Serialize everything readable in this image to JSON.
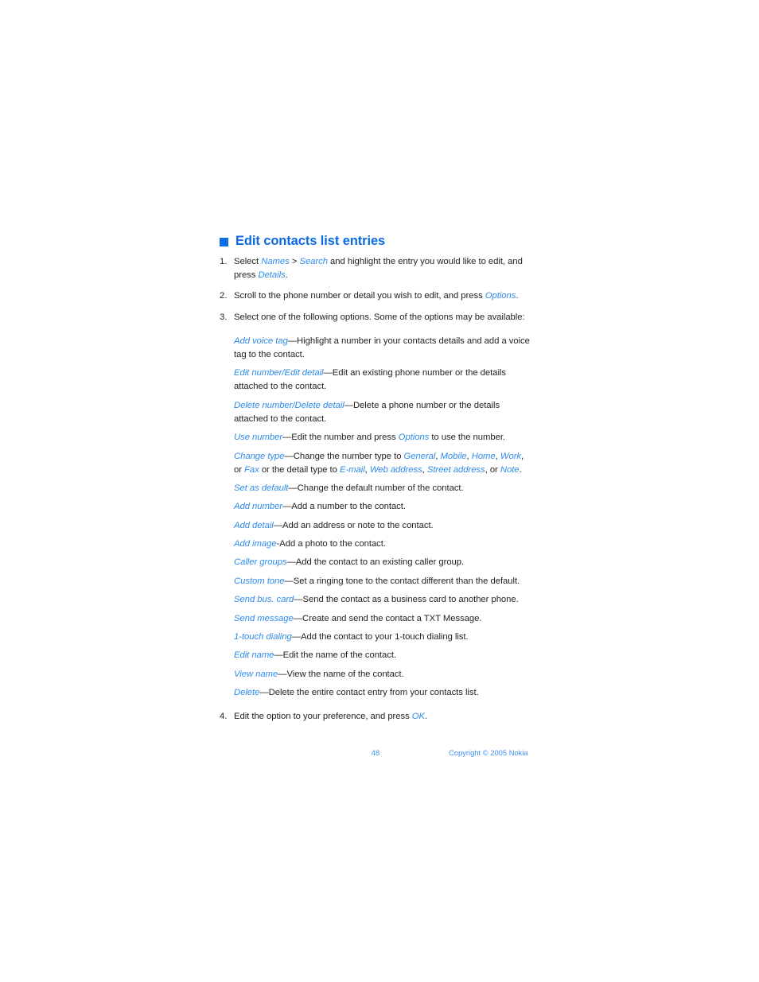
{
  "heading": {
    "bullet": "square-bullet",
    "title": "Edit contacts list entries"
  },
  "steps": [
    {
      "number": "1.",
      "parts": [
        {
          "t": "Select ",
          "s": "plain"
        },
        {
          "t": "Names",
          "s": "ui"
        },
        {
          "t": " > ",
          "s": "plain"
        },
        {
          "t": "Search",
          "s": "ui"
        },
        {
          "t": " and highlight the entry you would like to edit, and press ",
          "s": "plain"
        },
        {
          "t": "Details",
          "s": "ui"
        },
        {
          "t": ".",
          "s": "plain"
        }
      ]
    },
    {
      "number": "2.",
      "parts": [
        {
          "t": "Scroll to the phone number or detail you wish to edit, and press ",
          "s": "plain"
        },
        {
          "t": "Options",
          "s": "ui"
        },
        {
          "t": ".",
          "s": "plain"
        }
      ]
    },
    {
      "number": "3.",
      "parts": [
        {
          "t": "Select one of the following options. Some of the options may be available:",
          "s": "plain"
        }
      ]
    }
  ],
  "options": [
    {
      "name": "add-voice-tag",
      "parts": [
        {
          "t": "Add voice tag",
          "s": "ui"
        },
        {
          "t": "—Highlight a number in your contacts details and add a voice tag to the contact.",
          "s": "plain"
        }
      ]
    },
    {
      "name": "edit-number-edit-detail",
      "parts": [
        {
          "t": "Edit number",
          "s": "ui"
        },
        {
          "t": "/",
          "s": "sep"
        },
        {
          "t": "Edit detail",
          "s": "ui"
        },
        {
          "t": "—Edit an existing phone number or the details attached to the contact.",
          "s": "plain"
        }
      ]
    },
    {
      "name": "delete-number-delete-detail",
      "parts": [
        {
          "t": "Delete number",
          "s": "ui"
        },
        {
          "t": "/",
          "s": "sep"
        },
        {
          "t": "Delete detail",
          "s": "ui"
        },
        {
          "t": "—Delete a phone number or the details attached to the contact.",
          "s": "plain"
        }
      ]
    },
    {
      "name": "use-number",
      "parts": [
        {
          "t": "Use number",
          "s": "ui"
        },
        {
          "t": "—Edit the number and press ",
          "s": "plain"
        },
        {
          "t": "Options",
          "s": "ui"
        },
        {
          "t": " to use the number.",
          "s": "plain"
        }
      ]
    },
    {
      "name": "change-type",
      "parts": [
        {
          "t": "Change type",
          "s": "ui"
        },
        {
          "t": "—Change the number type to ",
          "s": "plain"
        },
        {
          "t": "General",
          "s": "ui"
        },
        {
          "t": ", ",
          "s": "plain"
        },
        {
          "t": "Mobile",
          "s": "ui"
        },
        {
          "t": ", ",
          "s": "plain"
        },
        {
          "t": "Home",
          "s": "ui"
        },
        {
          "t": ", ",
          "s": "plain"
        },
        {
          "t": "Work",
          "s": "ui"
        },
        {
          "t": ", or ",
          "s": "plain"
        },
        {
          "t": "Fax",
          "s": "ui"
        },
        {
          "t": " or the detail type to ",
          "s": "plain"
        },
        {
          "t": "E-mail",
          "s": "ui"
        },
        {
          "t": ", ",
          "s": "plain"
        },
        {
          "t": "Web address",
          "s": "ui"
        },
        {
          "t": ", ",
          "s": "plain"
        },
        {
          "t": "Street address",
          "s": "ui"
        },
        {
          "t": ", or ",
          "s": "plain"
        },
        {
          "t": "Note",
          "s": "ui"
        },
        {
          "t": ".",
          "s": "plain"
        }
      ]
    },
    {
      "name": "set-as-default",
      "parts": [
        {
          "t": "Set as default",
          "s": "ui"
        },
        {
          "t": "—Change the default number of the contact.",
          "s": "plain"
        }
      ]
    },
    {
      "name": "add-number",
      "parts": [
        {
          "t": "Add number",
          "s": "ui"
        },
        {
          "t": "—Add a number to the contact.",
          "s": "plain"
        }
      ]
    },
    {
      "name": "add-detail",
      "parts": [
        {
          "t": "Add detail",
          "s": "ui"
        },
        {
          "t": "—Add an address or note to the contact.",
          "s": "plain"
        }
      ]
    },
    {
      "name": "add-image",
      "parts": [
        {
          "t": "Add image",
          "s": "ui"
        },
        {
          "t": "-Add a photo to the contact.",
          "s": "plain"
        }
      ]
    },
    {
      "name": "caller-groups",
      "parts": [
        {
          "t": "Caller groups",
          "s": "ui"
        },
        {
          "t": "—Add the contact to an existing caller group.",
          "s": "plain"
        }
      ]
    },
    {
      "name": "custom-tone",
      "parts": [
        {
          "t": "Custom tone",
          "s": "ui"
        },
        {
          "t": "—Set a ringing tone to the contact different than the default.",
          "s": "plain"
        }
      ]
    },
    {
      "name": "send-bus-card",
      "parts": [
        {
          "t": "Send bus. card",
          "s": "ui"
        },
        {
          "t": "—Send the contact as a business card to another phone.",
          "s": "plain"
        }
      ]
    },
    {
      "name": "send-message",
      "parts": [
        {
          "t": "Send message",
          "s": "ui"
        },
        {
          "t": "—Create and send the contact a TXT Message.",
          "s": "plain"
        }
      ]
    },
    {
      "name": "one-touch-dialing",
      "parts": [
        {
          "t": "1-touch dialing",
          "s": "ui"
        },
        {
          "t": "—Add the contact to your 1-touch dialing list.",
          "s": "plain"
        }
      ]
    },
    {
      "name": "edit-name",
      "parts": [
        {
          "t": "Edit name",
          "s": "ui"
        },
        {
          "t": "—Edit the name of the contact.",
          "s": "plain"
        }
      ]
    },
    {
      "name": "view-name",
      "parts": [
        {
          "t": "View name",
          "s": "ui"
        },
        {
          "t": "—View the name of the contact.",
          "s": "plain"
        }
      ]
    },
    {
      "name": "delete",
      "parts": [
        {
          "t": "Delete",
          "s": "ui"
        },
        {
          "t": "—Delete the entire contact entry from your contacts list.",
          "s": "plain"
        }
      ]
    }
  ],
  "final_step": {
    "number": "4.",
    "parts": [
      {
        "t": "Edit the option to your preference, and press ",
        "s": "plain"
      },
      {
        "t": "OK",
        "s": "ui"
      },
      {
        "t": ".",
        "s": "plain"
      }
    ]
  },
  "footer": {
    "page_number": "48",
    "copyright": "Copyright © 2005 Nokia"
  },
  "colors": {
    "heading": "#0b6ae5",
    "bullet": "#0d6ee6",
    "ui_term": "#2d8bec",
    "body": "#231f20",
    "footer": "#3d8ff0"
  }
}
